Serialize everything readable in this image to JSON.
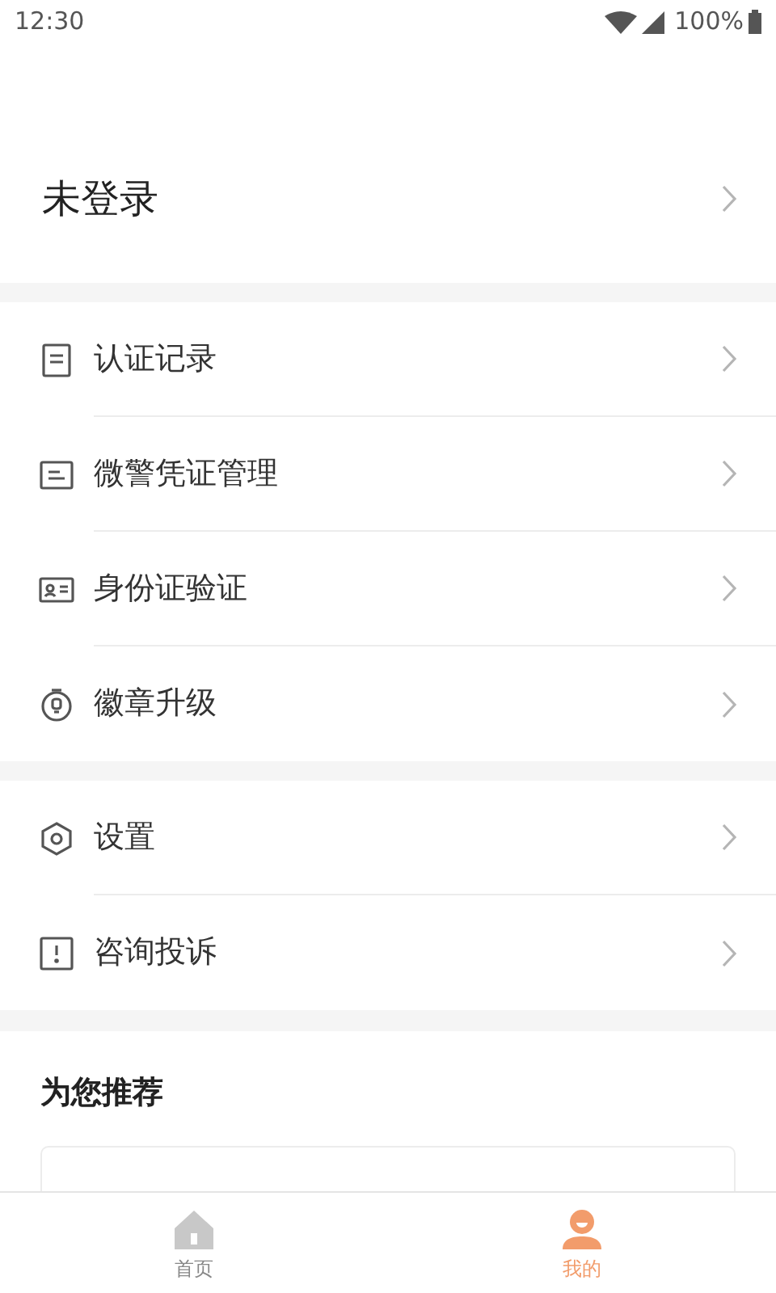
{
  "status_bar": {
    "time": "12:30",
    "battery": "100%"
  },
  "profile": {
    "name": "未登录"
  },
  "menu_groups": [
    [
      {
        "kind": "document",
        "label": "认证记录"
      },
      {
        "kind": "card",
        "label": "微警凭证管理"
      },
      {
        "kind": "id",
        "label": "身份证验证"
      },
      {
        "kind": "badge",
        "label": "徽章升级"
      }
    ],
    [
      {
        "kind": "settings",
        "label": "设置"
      },
      {
        "kind": "alert",
        "label": "咨询投诉"
      }
    ]
  ],
  "recommend": {
    "title": "为您推荐"
  },
  "tab_bar": [
    {
      "kind": "home",
      "label": "首页",
      "selected": false
    },
    {
      "kind": "user",
      "label": "我的",
      "selected": true
    }
  ]
}
